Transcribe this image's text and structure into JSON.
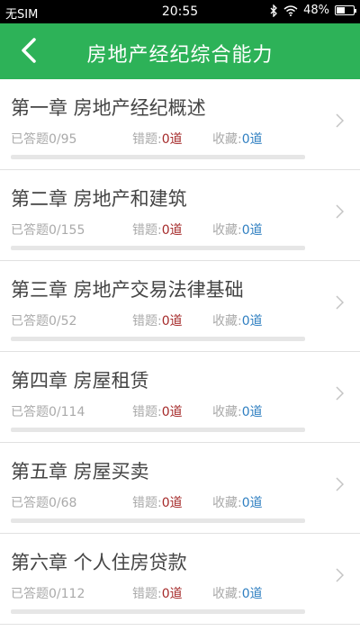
{
  "status_bar": {
    "carrier": "无SIM",
    "time": "20:55",
    "battery_text": "48%",
    "battery_level": 0.48,
    "icons": [
      "bluetooth-icon",
      "wifi-icon",
      "battery-icon"
    ]
  },
  "nav": {
    "title": "房地产经纪综合能力",
    "back_icon": "chevron-left-icon",
    "background": "#2db258"
  },
  "labels": {
    "answered_prefix": "已答题",
    "wrong_prefix": "错题:",
    "fav_prefix": "收藏:",
    "unit": "道"
  },
  "chapters": [
    {
      "title": "第一章 房地产经纪概述",
      "answered": "0/95",
      "wrong": "0",
      "fav": "0",
      "progress": 0
    },
    {
      "title": "第二章 房地产和建筑",
      "answered": "0/155",
      "wrong": "0",
      "fav": "0",
      "progress": 0
    },
    {
      "title": "第三章 房地产交易法律基础",
      "answered": "0/52",
      "wrong": "0",
      "fav": "0",
      "progress": 0
    },
    {
      "title": "第四章 房屋租赁",
      "answered": "0/114",
      "wrong": "0",
      "fav": "0",
      "progress": 0
    },
    {
      "title": "第五章 房屋买卖",
      "answered": "0/68",
      "wrong": "0",
      "fav": "0",
      "progress": 0
    },
    {
      "title": "第六章 个人住房贷款",
      "answered": "0/112",
      "wrong": "0",
      "fav": "0",
      "progress": 0
    }
  ]
}
